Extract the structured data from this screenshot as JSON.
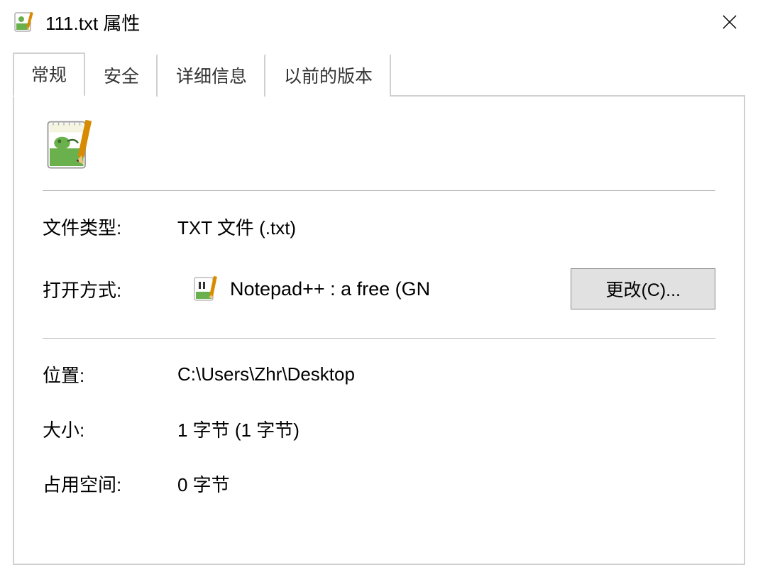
{
  "title": "111.txt 属性",
  "tabs": [
    {
      "label": "常规",
      "active": true
    },
    {
      "label": "安全",
      "active": false
    },
    {
      "label": "详细信息",
      "active": false
    },
    {
      "label": "以前的版本",
      "active": false
    }
  ],
  "general": {
    "fileTypeLabel": "文件类型:",
    "fileTypeValue": "TXT 文件 (.txt)",
    "openWithLabel": "打开方式:",
    "openWithApp": "Notepad++ : a free (GN",
    "changeButton": "更改(C)...",
    "locationLabel": "位置:",
    "locationValue": "C:\\Users\\Zhr\\Desktop",
    "sizeLabel": "大小:",
    "sizeValue": "1 字节 (1 字节)",
    "sizeOnDiskLabel": "占用空间:",
    "sizeOnDiskValue": "0 字节"
  }
}
